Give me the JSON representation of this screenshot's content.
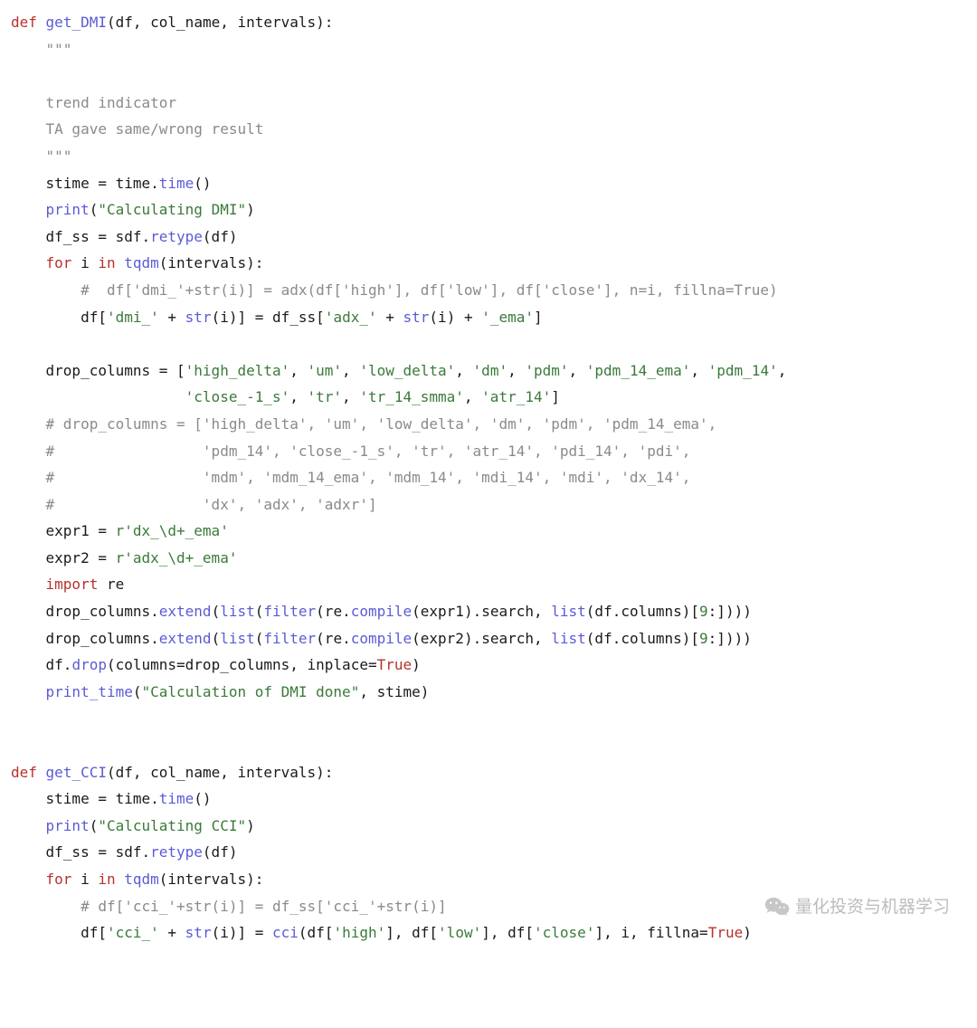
{
  "code": {
    "lines": [
      [
        [
          "kw",
          "def"
        ],
        [
          "plain",
          " "
        ],
        [
          "fn",
          "get_DMI"
        ],
        [
          "plain",
          "(df, col_name, intervals):"
        ]
      ],
      [
        [
          "plain",
          "    "
        ],
        [
          "doc",
          "\"\"\""
        ]
      ],
      [
        [
          "plain",
          "    "
        ]
      ],
      [
        [
          "plain",
          "    "
        ],
        [
          "doc",
          "trend indicator"
        ]
      ],
      [
        [
          "plain",
          "    "
        ],
        [
          "doc",
          "TA gave same/wrong result"
        ]
      ],
      [
        [
          "plain",
          "    "
        ],
        [
          "doc",
          "\"\"\""
        ]
      ],
      [
        [
          "plain",
          "    stime = time."
        ],
        [
          "attr",
          "time"
        ],
        [
          "plain",
          "()"
        ]
      ],
      [
        [
          "plain",
          "    "
        ],
        [
          "attr",
          "print"
        ],
        [
          "plain",
          "("
        ],
        [
          "str",
          "\"Calculating DMI\""
        ],
        [
          "plain",
          ")"
        ]
      ],
      [
        [
          "plain",
          "    df_ss = sdf."
        ],
        [
          "attr",
          "retype"
        ],
        [
          "plain",
          "(df)"
        ]
      ],
      [
        [
          "plain",
          "    "
        ],
        [
          "kw",
          "for"
        ],
        [
          "plain",
          " i "
        ],
        [
          "kw",
          "in"
        ],
        [
          "plain",
          " "
        ],
        [
          "attr",
          "tqdm"
        ],
        [
          "plain",
          "(intervals):"
        ]
      ],
      [
        [
          "plain",
          "        "
        ],
        [
          "cmt",
          "#  df['dmi_'+str(i)] = adx(df['high'], df['low'], df['close'], n=i, fillna=True)"
        ]
      ],
      [
        [
          "plain",
          "        df["
        ],
        [
          "str",
          "'dmi_'"
        ],
        [
          "plain",
          " + "
        ],
        [
          "attr",
          "str"
        ],
        [
          "plain",
          "(i)] = df_ss["
        ],
        [
          "str",
          "'adx_'"
        ],
        [
          "plain",
          " + "
        ],
        [
          "attr",
          "str"
        ],
        [
          "plain",
          "(i) + "
        ],
        [
          "str",
          "'_ema'"
        ],
        [
          "plain",
          "]"
        ]
      ],
      [
        [
          "plain",
          ""
        ]
      ],
      [
        [
          "plain",
          "    drop_columns = ["
        ],
        [
          "str",
          "'high_delta'"
        ],
        [
          "plain",
          ", "
        ],
        [
          "str",
          "'um'"
        ],
        [
          "plain",
          ", "
        ],
        [
          "str",
          "'low_delta'"
        ],
        [
          "plain",
          ", "
        ],
        [
          "str",
          "'dm'"
        ],
        [
          "plain",
          ", "
        ],
        [
          "str",
          "'pdm'"
        ],
        [
          "plain",
          ", "
        ],
        [
          "str",
          "'pdm_14_ema'"
        ],
        [
          "plain",
          ", "
        ],
        [
          "str",
          "'pdm_14'"
        ],
        [
          "plain",
          ","
        ]
      ],
      [
        [
          "plain",
          "                    "
        ],
        [
          "str",
          "'close_-1_s'"
        ],
        [
          "plain",
          ", "
        ],
        [
          "str",
          "'tr'"
        ],
        [
          "plain",
          ", "
        ],
        [
          "str",
          "'tr_14_smma'"
        ],
        [
          "plain",
          ", "
        ],
        [
          "str",
          "'atr_14'"
        ],
        [
          "plain",
          "]"
        ]
      ],
      [
        [
          "plain",
          "    "
        ],
        [
          "cmt",
          "# drop_columns = ['high_delta', 'um', 'low_delta', 'dm', 'pdm', 'pdm_14_ema',"
        ]
      ],
      [
        [
          "plain",
          "    "
        ],
        [
          "cmt",
          "#                 'pdm_14', 'close_-1_s', 'tr', 'atr_14', 'pdi_14', 'pdi',"
        ]
      ],
      [
        [
          "plain",
          "    "
        ],
        [
          "cmt",
          "#                 'mdm', 'mdm_14_ema', 'mdm_14', 'mdi_14', 'mdi', 'dx_14',"
        ]
      ],
      [
        [
          "plain",
          "    "
        ],
        [
          "cmt",
          "#                 'dx', 'adx', 'adxr']"
        ]
      ],
      [
        [
          "plain",
          "    expr1 = "
        ],
        [
          "str",
          "r'dx_\\d+_ema'"
        ]
      ],
      [
        [
          "plain",
          "    expr2 = "
        ],
        [
          "str",
          "r'adx_\\d+_ema'"
        ]
      ],
      [
        [
          "plain",
          "    "
        ],
        [
          "kw",
          "import"
        ],
        [
          "plain",
          " re"
        ]
      ],
      [
        [
          "plain",
          "    drop_columns."
        ],
        [
          "attr",
          "extend"
        ],
        [
          "plain",
          "("
        ],
        [
          "attr",
          "list"
        ],
        [
          "plain",
          "("
        ],
        [
          "attr",
          "filter"
        ],
        [
          "plain",
          "(re."
        ],
        [
          "attr",
          "compile"
        ],
        [
          "plain",
          "(expr1).search, "
        ],
        [
          "attr",
          "list"
        ],
        [
          "plain",
          "(df.columns)["
        ],
        [
          "num",
          "9"
        ],
        [
          "plain",
          ":])))"
        ]
      ],
      [
        [
          "plain",
          "    drop_columns."
        ],
        [
          "attr",
          "extend"
        ],
        [
          "plain",
          "("
        ],
        [
          "attr",
          "list"
        ],
        [
          "plain",
          "("
        ],
        [
          "attr",
          "filter"
        ],
        [
          "plain",
          "(re."
        ],
        [
          "attr",
          "compile"
        ],
        [
          "plain",
          "(expr2).search, "
        ],
        [
          "attr",
          "list"
        ],
        [
          "plain",
          "(df.columns)["
        ],
        [
          "num",
          "9"
        ],
        [
          "plain",
          ":])))"
        ]
      ],
      [
        [
          "plain",
          "    df."
        ],
        [
          "attr",
          "drop"
        ],
        [
          "plain",
          "(columns=drop_columns, inplace="
        ],
        [
          "bool",
          "True"
        ],
        [
          "plain",
          ")"
        ]
      ],
      [
        [
          "plain",
          "    "
        ],
        [
          "attr",
          "print_time"
        ],
        [
          "plain",
          "("
        ],
        [
          "str",
          "\"Calculation of DMI done\""
        ],
        [
          "plain",
          ", stime)"
        ]
      ],
      [
        [
          "plain",
          ""
        ]
      ],
      [
        [
          "plain",
          ""
        ]
      ],
      [
        [
          "kw",
          "def"
        ],
        [
          "plain",
          " "
        ],
        [
          "fn",
          "get_CCI"
        ],
        [
          "plain",
          "(df, col_name, intervals):"
        ]
      ],
      [
        [
          "plain",
          "    stime = time."
        ],
        [
          "attr",
          "time"
        ],
        [
          "plain",
          "()"
        ]
      ],
      [
        [
          "plain",
          "    "
        ],
        [
          "attr",
          "print"
        ],
        [
          "plain",
          "("
        ],
        [
          "str",
          "\"Calculating CCI\""
        ],
        [
          "plain",
          ")"
        ]
      ],
      [
        [
          "plain",
          "    df_ss = sdf."
        ],
        [
          "attr",
          "retype"
        ],
        [
          "plain",
          "(df)"
        ]
      ],
      [
        [
          "plain",
          "    "
        ],
        [
          "kw",
          "for"
        ],
        [
          "plain",
          " i "
        ],
        [
          "kw",
          "in"
        ],
        [
          "plain",
          " "
        ],
        [
          "attr",
          "tqdm"
        ],
        [
          "plain",
          "(intervals):"
        ]
      ],
      [
        [
          "plain",
          "        "
        ],
        [
          "cmt",
          "# df['cci_'+str(i)] = df_ss['cci_'+str(i)]"
        ]
      ],
      [
        [
          "plain",
          "        df["
        ],
        [
          "str",
          "'cci_'"
        ],
        [
          "plain",
          " + "
        ],
        [
          "attr",
          "str"
        ],
        [
          "plain",
          "(i)] = "
        ],
        [
          "attr",
          "cci"
        ],
        [
          "plain",
          "(df["
        ],
        [
          "str",
          "'high'"
        ],
        [
          "plain",
          "], df["
        ],
        [
          "str",
          "'low'"
        ],
        [
          "plain",
          "], df["
        ],
        [
          "str",
          "'close'"
        ],
        [
          "plain",
          "], i, fillna="
        ],
        [
          "bool",
          "True"
        ],
        [
          "plain",
          ")"
        ]
      ]
    ]
  },
  "watermark": {
    "text": "量化投资与机器学习"
  }
}
